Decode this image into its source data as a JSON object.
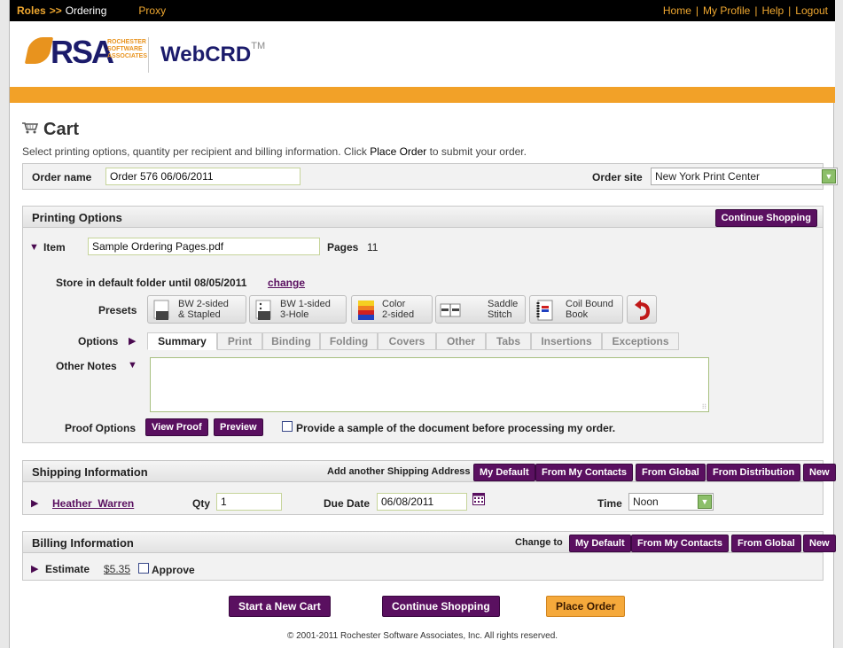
{
  "topbar": {
    "roles": "Roles",
    "ordering": "Ordering",
    "proxy": "Proxy",
    "links": [
      "Home",
      "My Profile",
      "Help",
      "Logout"
    ]
  },
  "brand": {
    "logo_text": "RSA",
    "logo_sub": [
      "ROCHESTER",
      "SOFTWARE",
      "ASSOCIATES"
    ],
    "product": "WebCRD",
    "tm": "TM"
  },
  "cart": {
    "title": "Cart",
    "instructions_pre": "Select printing options, quantity per recipient and billing information. Click ",
    "instructions_strong": "Place Order",
    "instructions_post": " to submit your order."
  },
  "order": {
    "name_label": "Order name",
    "name_value": "Order 576 06/06/2011",
    "site_label": "Order site",
    "site_value": "New York Print Center"
  },
  "printing": {
    "title": "Printing Options",
    "continue_shopping": "Continue Shopping",
    "item_label": "Item",
    "item_value": "Sample Ordering Pages.pdf",
    "pages_label": "Pages",
    "pages_value": "11",
    "store_text": "Store in default folder until 08/05/2011",
    "change": "change",
    "presets_label": "Presets",
    "presets": [
      {
        "line1": "BW 2-sided",
        "line2": "& Stapled"
      },
      {
        "line1": "BW 1-sided",
        "line2": "3-Hole"
      },
      {
        "line1": "Color",
        "line2": "2-sided"
      },
      {
        "line1": "Saddle",
        "line2": "Stitch"
      },
      {
        "line1": "Coil Bound",
        "line2": "Book"
      }
    ],
    "options_label": "Options",
    "tabs": [
      "Summary",
      "Print",
      "Binding",
      "Folding",
      "Covers",
      "Other",
      "Tabs",
      "Insertions",
      "Exceptions"
    ],
    "other_notes_label": "Other Notes",
    "proof_label": "Proof Options",
    "view_proof": "View Proof",
    "preview": "Preview",
    "sample_text": "Provide a sample of the document before processing my order."
  },
  "shipping": {
    "title": "Shipping Information",
    "add_label": "Add another Shipping Address",
    "buttons": [
      "My Default",
      "From My Contacts",
      "From Global",
      "From Distribution",
      "New"
    ],
    "recipient": "Heather_Warren",
    "qty_label": "Qty",
    "qty_value": "1",
    "due_label": "Due Date",
    "due_value": "06/08/2011",
    "time_label": "Time",
    "time_value": "Noon"
  },
  "billing": {
    "title": "Billing Information",
    "change_label": "Change to",
    "buttons": [
      "My Default",
      "From My Contacts",
      "From Global",
      "New"
    ],
    "estimate_label": "Estimate",
    "estimate_value": "$5.35",
    "approve": "Approve"
  },
  "actions": {
    "new_cart": "Start a New Cart",
    "continue": "Continue Shopping",
    "place": "Place Order"
  },
  "footer": {
    "copyright": "© 2001-2011 Rochester Software Associates, Inc. All rights reserved."
  },
  "colors": {
    "brand_purple": "#5a1060",
    "brand_orange": "#f2a128",
    "topbar": "#000000"
  }
}
